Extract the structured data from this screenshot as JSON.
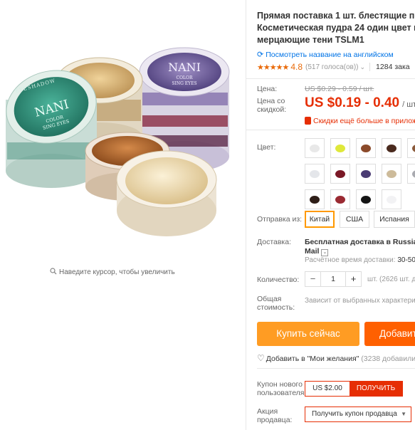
{
  "gallery": {
    "zoom_hint": "Наведите курсор, чтобы увеличить",
    "jar_lid_text": [
      "NANI",
      "COLOR",
      "SING EYES"
    ],
    "jar_ring_text": "EYESHADOW"
  },
  "product": {
    "title_lines": [
      "Прямая поставка 1 шт. блестящие перл",
      "Косметическая пудра 24 один цвет пиг",
      "мерцающие тени TSLM1"
    ],
    "translate_link": "Посмотреть название на английском",
    "rating": "4.8",
    "votes": "(517 голоса(ов))",
    "orders": "1284 зака"
  },
  "price": {
    "label": "Цена:",
    "old": "US $0.29 - 0.59 / шт.",
    "discount_label_lines": [
      "Цена со",
      "скидкой:"
    ],
    "current": "US $0.19 - 0.40",
    "unit": "/ шт.",
    "app_promo": "Скидки ещё больше в приложе"
  },
  "color": {
    "label": "Цвет:",
    "swatches": [
      {
        "name": "white",
        "color": "#e8e8e8"
      },
      {
        "name": "yellow",
        "color": "#dfe83a"
      },
      {
        "name": "bronze",
        "color": "#8b4a2a"
      },
      {
        "name": "dark-brown",
        "color": "#4a2a1e"
      },
      {
        "name": "brown",
        "color": "#8a5a3a"
      },
      {
        "name": "silver",
        "color": "#e4e6ea"
      },
      {
        "name": "wine",
        "color": "#7a1826"
      },
      {
        "name": "purple",
        "color": "#4a3b73"
      },
      {
        "name": "champagne",
        "color": "#cdbb9a"
      },
      {
        "name": "gray",
        "color": "#a9aab0"
      },
      {
        "name": "black-brown",
        "color": "#2e1e18"
      },
      {
        "name": "red",
        "color": "#9a2a32"
      },
      {
        "name": "black",
        "color": "#151515"
      },
      {
        "name": "pearl",
        "color": "#f2f2f4"
      }
    ]
  },
  "shipping_from": {
    "label": "Отправка из:",
    "options": [
      "Китай",
      "США",
      "Испания"
    ],
    "selected": "Китай"
  },
  "delivery": {
    "label": "Доставка:",
    "method_line1": "Бесплатная доставка в Russian",
    "method_line2": "Mail",
    "estimate_label": "Расчётное время доставки:",
    "estimate_value": "30-50"
  },
  "quantity": {
    "label": "Количество:",
    "value": "1",
    "minus": "−",
    "plus": "+",
    "available": "шт. (2626 шт. д"
  },
  "total": {
    "label_lines": [
      "Общая",
      "стоимость:"
    ],
    "value": "Зависит от выбранных характери"
  },
  "actions": {
    "buy": "Купить сейчас",
    "cart": "Добавит",
    "wishlist": "Добавить в \"Мои желания\"",
    "wishlist_count": "(3238 добавили)"
  },
  "coupon": {
    "label_lines": [
      "Купон нового",
      "пользователя"
    ],
    "amount": "US $2.00",
    "get": "ПОЛУЧИТЬ"
  },
  "seller_promo": {
    "label_lines": [
      "Акция",
      "продавца:"
    ],
    "select_value": "Получить купон продавца"
  },
  "colors": {
    "accent_red": "#e62e04",
    "buy_orange": "#ff9c23",
    "cart_orange": "#ff6000",
    "link_blue": "#0073e6",
    "star_orange": "#e96a09",
    "selected_border": "#ff9900"
  }
}
